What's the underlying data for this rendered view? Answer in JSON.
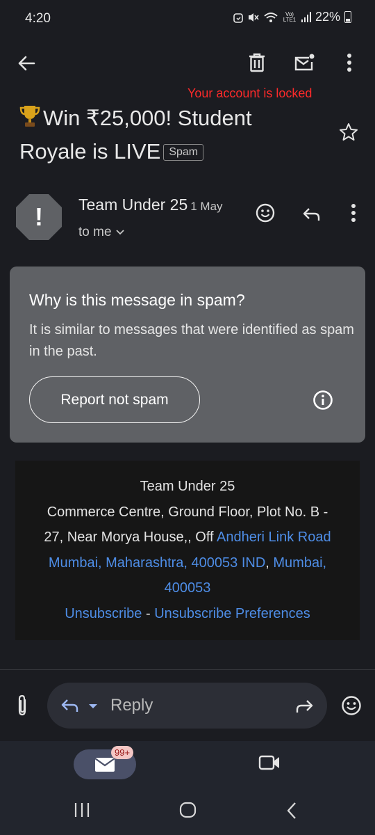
{
  "status_bar": {
    "time": "4:20",
    "battery": "22%",
    "network": "Vo) LTE1"
  },
  "toolbar": {
    "locked_notice": "Your account is locked"
  },
  "email": {
    "subject_prefix": "Win ₹25,000! Student",
    "subject_line2": "Royale is LIVE",
    "label_chip": "Spam",
    "sender": "Team Under 25",
    "date": "1 May",
    "recipient": "to me",
    "avatar_symbol": "!"
  },
  "spam_card": {
    "title": "Why is this message in spam?",
    "description": "It is similar to messages that were identified as spam in the past.",
    "button": "Report not spam"
  },
  "footer": {
    "line1": "Team Under 25",
    "address_a": "Commerce Centre, Ground Floor, Plot No. B -",
    "address_b": "27, Near Morya House,, Off ",
    "address_link1": "Andheri Link Road",
    "address_link2": "Mumbai, Maharashtra, 400053 IND",
    "address_comma": ", ",
    "address_link3": "Mumbai,",
    "address_link4": "400053",
    "unsubscribe": "Unsubscribe",
    "separator": " - ",
    "unsubscribe_prefs": "Unsubscribe Preferences"
  },
  "reply_bar": {
    "placeholder": "Reply"
  },
  "bottom_nav": {
    "mail_badge": "99+"
  },
  "colors": {
    "background": "#1b1c21",
    "spam_card": "#5f6165",
    "link": "#4e8de6",
    "locked": "#ff2a2a"
  }
}
